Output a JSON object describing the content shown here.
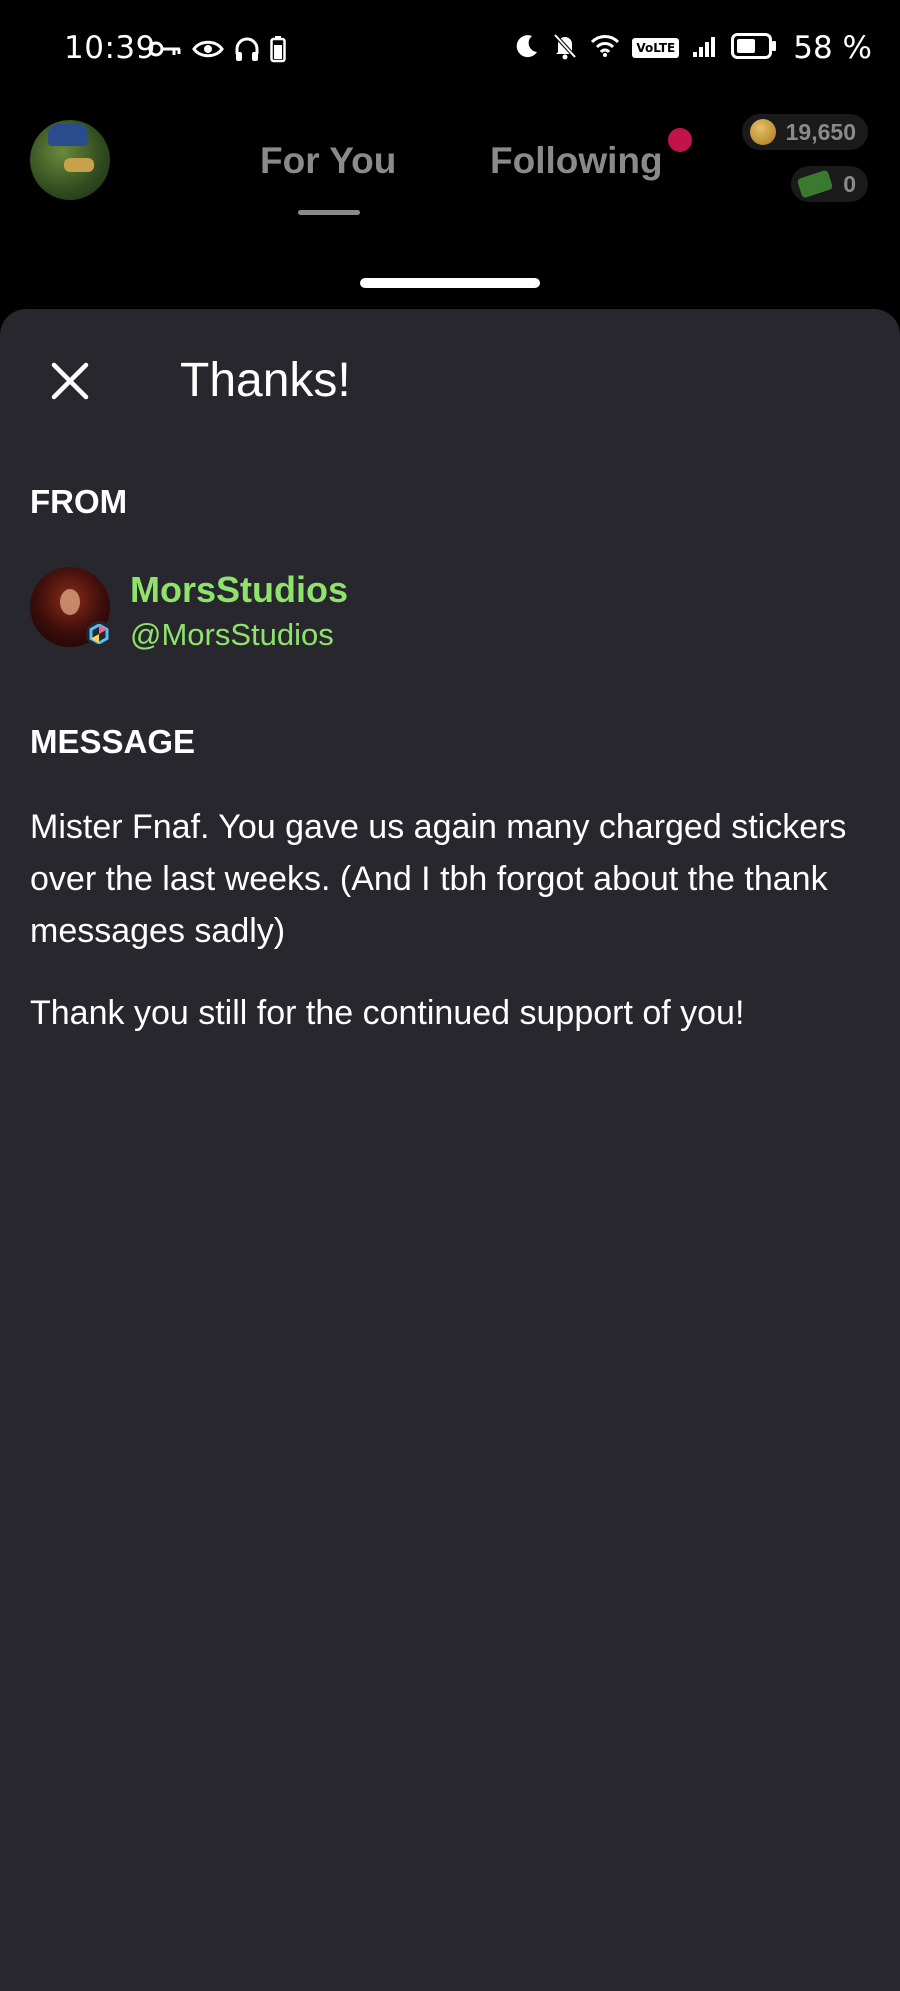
{
  "status_bar": {
    "time": "10:39",
    "network_badge": "VoLTE",
    "battery": "58 %"
  },
  "header": {
    "tabs": [
      {
        "label": "For You",
        "active": true
      },
      {
        "label": "Following",
        "active": false
      }
    ],
    "coins": "19,650",
    "cash": "0",
    "colors": {
      "notification_dot": "#c2134a",
      "tab_inactive": "#8a8a8a"
    }
  },
  "sheet": {
    "title": "Thanks!",
    "from_label": "FROM",
    "sender": {
      "name": "MorsStudios",
      "handle": "@MorsStudios",
      "color": "#8ee36b"
    },
    "message_label": "MESSAGE",
    "message_paragraphs": [
      "Mister Fnaf. You gave us again many charged stickers over the last weeks. (And I tbh forgot about the thank messages sadly)",
      "Thank you still for the continued support of you!"
    ],
    "background": "#28272e"
  }
}
